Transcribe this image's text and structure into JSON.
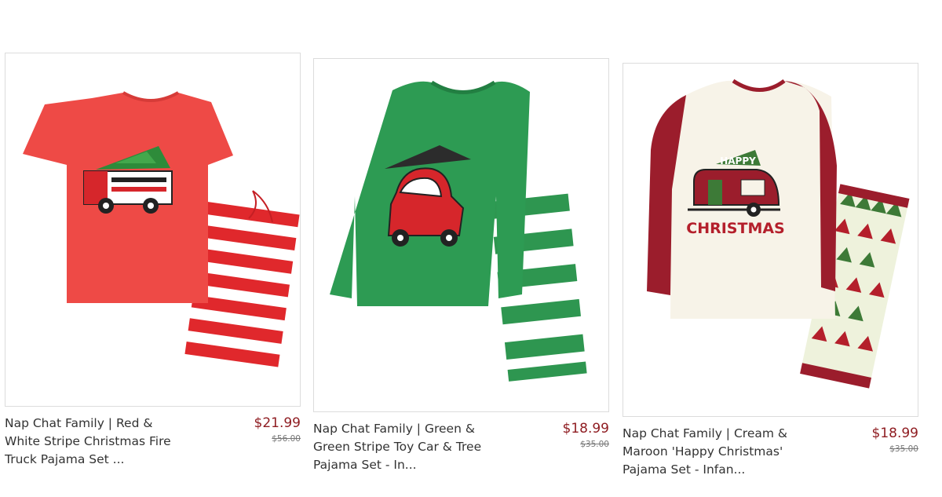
{
  "products": [
    {
      "title_lines": [
        "Nap Chat Family | Red &",
        "White Stripe Christmas Fire",
        "Truck Pajama Set ..."
      ],
      "price": "$21.99",
      "original_price": "$56.00",
      "colors": {
        "shirt": "#ee4a46",
        "stripe": "#e0282c"
      }
    },
    {
      "title_lines": [
        "Nap Chat Family | Green &",
        "Green Stripe Toy Car & Tree",
        "Pajama Set - In..."
      ],
      "price": "$18.99",
      "original_price": "$35.00",
      "colors": {
        "shirt": "#2d9b53",
        "stripe": "#2e9650"
      }
    },
    {
      "title_lines": [
        "Nap Chat Family | Cream &",
        "Maroon 'Happy Christmas'",
        "Pajama Set - Infan..."
      ],
      "price": "$18.99",
      "original_price": "$35.00",
      "colors": {
        "body": "#f7f3e8",
        "sleeve": "#9b1d2c",
        "text": "#b41f2b"
      },
      "graphic_text": {
        "top": "HAPPY",
        "bottom": "CHRISTMAS"
      }
    }
  ]
}
